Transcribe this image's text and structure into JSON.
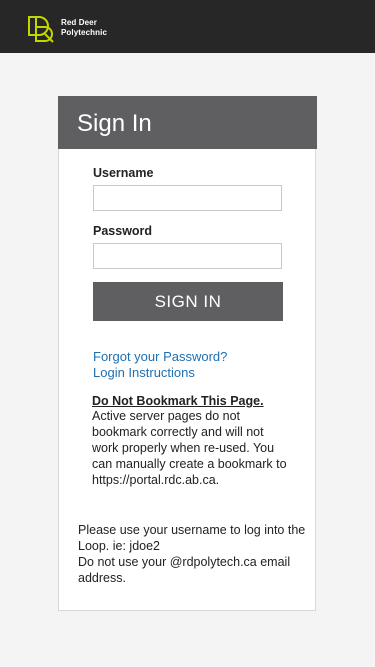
{
  "brand": {
    "logo_icon": "rd-monogram-icon",
    "name_line1": "Red Deer",
    "name_line2": "Polytechnic",
    "accent_color": "#c4d600"
  },
  "signin": {
    "title": "Sign In",
    "username_label": "Username",
    "username_value": "",
    "password_label": "Password",
    "password_value": "",
    "button_label": "SIGN IN",
    "forgot_link": "Forgot your Password?",
    "instructions_link": "Login Instructions"
  },
  "notice": {
    "title": "Do Not Bookmark This Page.",
    "body": "Active server pages do not bookmark correctly and will not work properly when re-used. You can manually create a bookmark to https://portal.rdc.ab.ca."
  },
  "footer": {
    "line1": "Please use your username to log into the Loop. ie: jdoe2",
    "line2": "Do not use your @rdpolytech.ca email address."
  }
}
